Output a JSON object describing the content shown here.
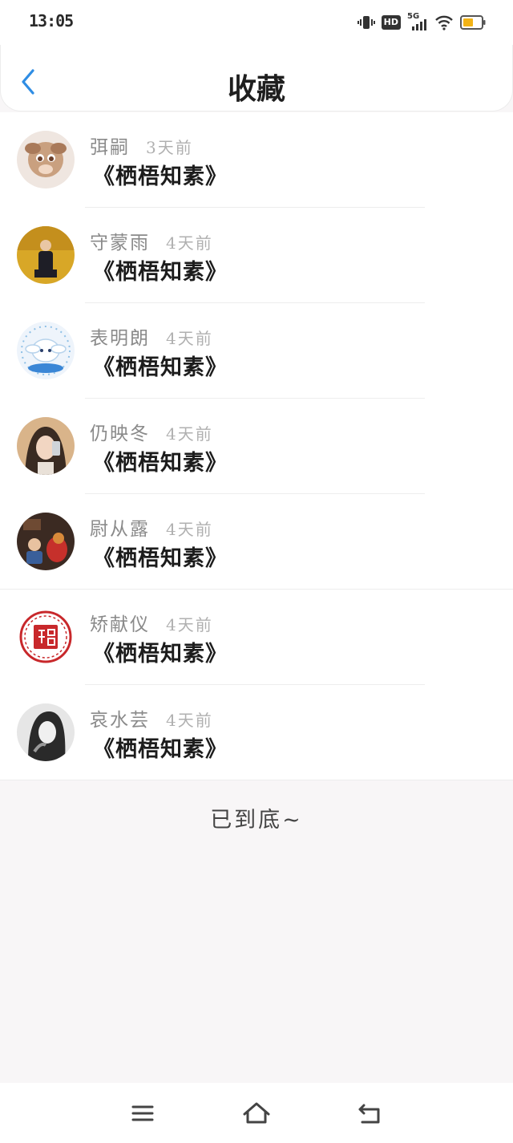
{
  "status_bar": {
    "time": "13:05",
    "network": "5G",
    "hd": "HD"
  },
  "header": {
    "title": "收藏"
  },
  "items": [
    {
      "name": "弭嗣",
      "time": "3天前",
      "title": "《栖梧知素》"
    },
    {
      "name": "守蒙雨",
      "time": "4天前",
      "title": "《栖梧知素》"
    },
    {
      "name": "表明朗",
      "time": "4天前",
      "title": "《栖梧知素》"
    },
    {
      "name": "仍映冬",
      "time": "4天前",
      "title": "《栖梧知素》"
    },
    {
      "name": "尉从露",
      "time": "4天前",
      "title": "《栖梧知素》"
    },
    {
      "name": "矫献仪",
      "time": "4天前",
      "title": "《栖梧知素》"
    },
    {
      "name": "哀水芸",
      "time": "4天前",
      "title": "《栖梧知素》"
    }
  ],
  "footer": {
    "end_text": "已到底~"
  },
  "colors": {
    "accent": "#2f8de4",
    "title": "#1c1c1c",
    "meta": "#8a8a8a",
    "background": "#f8f6f7"
  }
}
